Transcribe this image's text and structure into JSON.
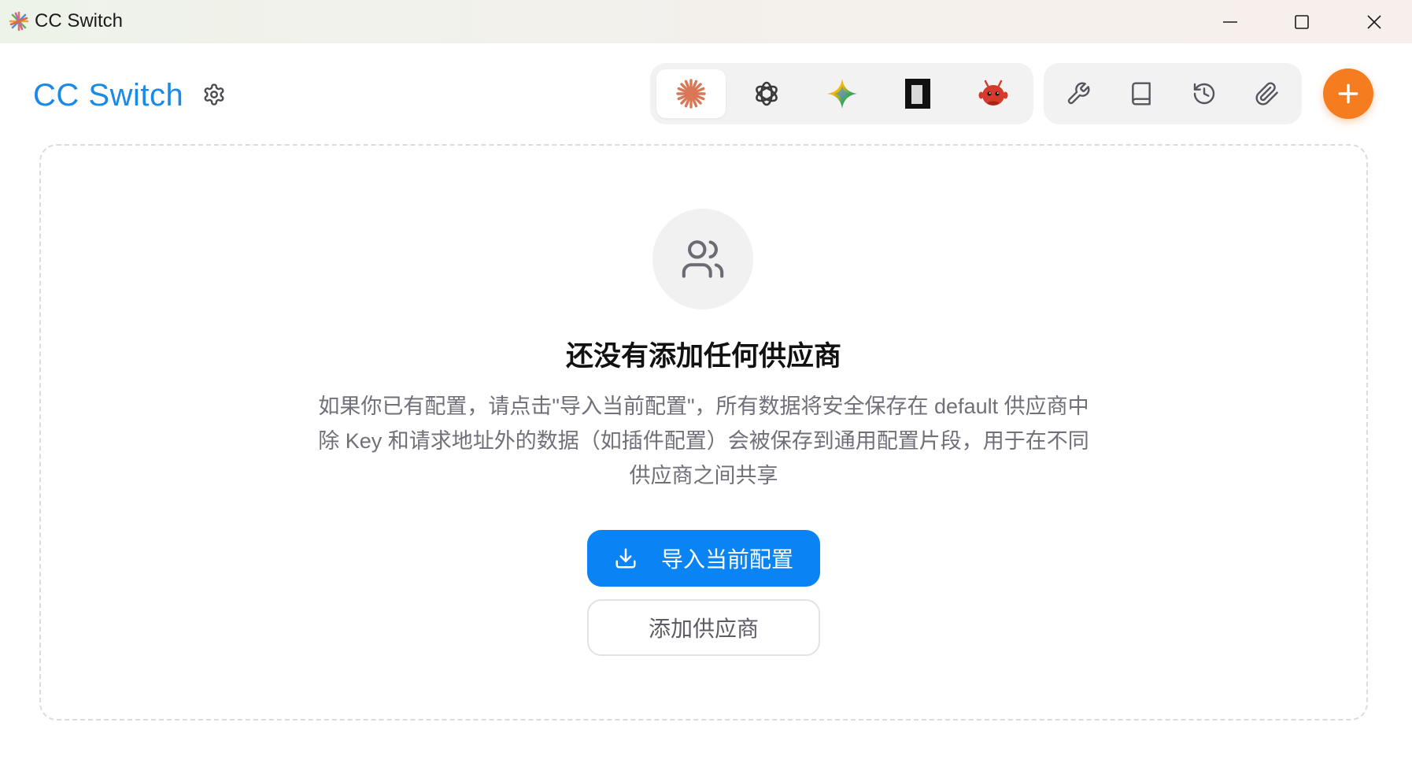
{
  "window": {
    "title": "CC Switch",
    "controls": [
      "minimize-icon",
      "maximize-icon",
      "close-icon"
    ]
  },
  "header": {
    "brand": "CC Switch",
    "settings_icon": "gear-icon",
    "app_tabs": [
      {
        "name": "claude",
        "icon": "claude-sunburst-icon",
        "active": true,
        "color": "#d97757"
      },
      {
        "name": "openai",
        "icon": "openai-knot-icon",
        "active": false,
        "color": "#3a3a3a"
      },
      {
        "name": "gemini",
        "icon": "gemini-sparkle-icon",
        "active": false
      },
      {
        "name": "app-4",
        "icon": "black-square-app-icon",
        "active": false,
        "color": "#111111"
      },
      {
        "name": "app-5",
        "icon": "red-creature-icon",
        "active": false,
        "color": "#d63a2a"
      }
    ],
    "tools": [
      {
        "name": "tools",
        "icon": "wrench-icon"
      },
      {
        "name": "docs",
        "icon": "book-icon"
      },
      {
        "name": "history",
        "icon": "history-icon"
      },
      {
        "name": "attachments",
        "icon": "paperclip-icon"
      }
    ],
    "add_icon": "plus-icon",
    "accent": "#f57c1f",
    "brand_color": "#1a8ae8"
  },
  "empty_state": {
    "icon": "users-icon",
    "title": "还没有添加任何供应商",
    "description_lines": [
      "如果你已有配置，请点击\"导入当前配置\"，所有数据将安全保存在 default 供应商中",
      "除 Key 和请求地址外的数据（如插件配置）会被保存到通用配置片段，用于在不同",
      "供应商之间共享"
    ],
    "import_button": "导入当前配置",
    "import_icon": "download-icon",
    "add_provider_button": "添加供应商",
    "primary_color": "#0a84f5"
  }
}
